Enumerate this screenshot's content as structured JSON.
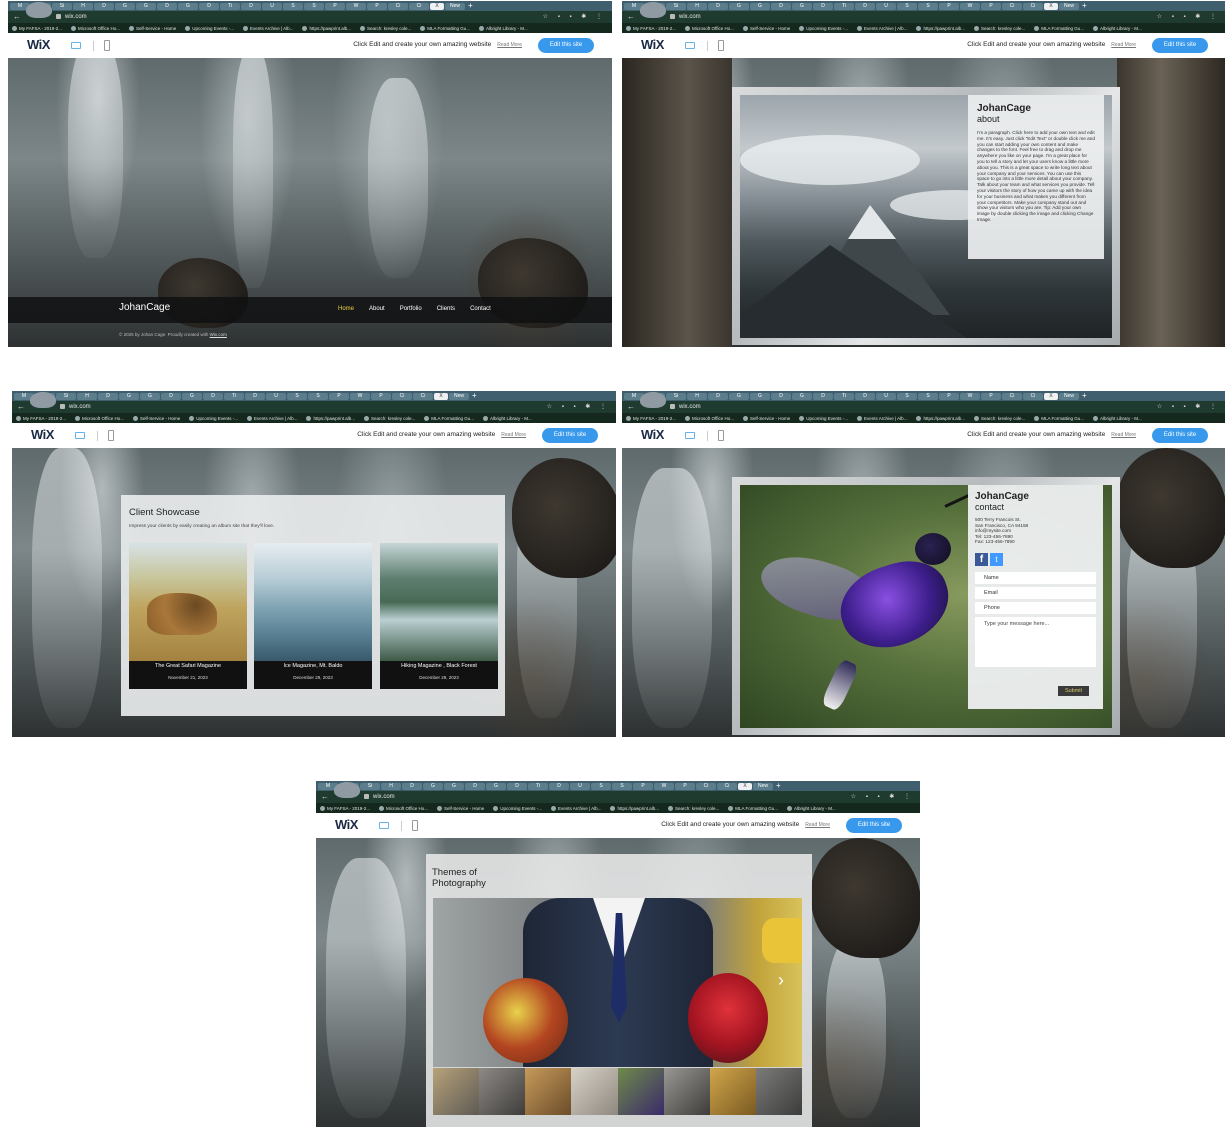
{
  "browser": {
    "url": "wix.com",
    "tabs": [
      "M",
      "Ir",
      "Si",
      "H",
      "D",
      "G",
      "G",
      "D",
      "G",
      "D",
      "Ti",
      "D",
      "U",
      "S",
      "S",
      "P",
      "W",
      "P",
      "Ci",
      "Ci",
      "U",
      "Ir",
      "N",
      "Di",
      "P",
      "X"
    ],
    "new_tab": "New",
    "bookmarks": [
      "My FAFSA - 2019-2...",
      "Microsoft Office Ho...",
      "Self-Service - Home",
      "Upcoming Events -...",
      "Events Archive | Alb...",
      "https://pawprint.alb...",
      "Search: kresley cole...",
      "MLA Formatting Gu...",
      "Albright Library - M..."
    ]
  },
  "wix": {
    "logo": "WiX",
    "promo": "Click Edit and create your own amazing website",
    "read_more": "Read More",
    "edit_button": "Edit this site"
  },
  "home": {
    "brand": "JohanCage",
    "nav": [
      "Home",
      "About",
      "Portfolio",
      "Clients",
      "Contact"
    ],
    "footer_text": "© 2025 by Johan Cage. Proudly created with",
    "footer_link": "Wix.com"
  },
  "about": {
    "name": "JohanCage",
    "heading": "about",
    "body": "I'm a paragraph. Click here to add your own text and edit me. It's easy. Just click “Edit Text” or double click me and you can start adding your own content and make changes to the font. Feel free to drag and drop me anywhere you like on your page. I'm a great place for you to tell a story and let your users know a little more about you. This is a great space to write long text about your company and your services. You can use this space to go into a little more detail about your company. Talk about your team and what services you provide. Tell your visitors the story of how you came up with the idea for your business and what makes you different from your competitors. Make your company stand out and show your visitors who you are. Tip: Add your own image by double clicking the image and clicking Change Image."
  },
  "clients": {
    "title": "Client Showcase",
    "subtitle": "Impress your clients by easily creating an album site that they'll love.",
    "items": [
      {
        "caption": "The Great Safari Magazine",
        "date": "November 21, 2023"
      },
      {
        "caption": "Ice Magazine, Mt. Baldo",
        "date": "December 29, 2023"
      },
      {
        "caption": "Hiking Magazine , Black Forest",
        "date": "December 29, 2023"
      }
    ]
  },
  "contact": {
    "name": "JohanCage",
    "heading": "contact",
    "address1": "500 Terry Francois St.",
    "address2": "San Francisco, CA 94158",
    "email": "info@mysite.com",
    "tel": "Tel: 123-456-7890",
    "fax": "Fax: 123-456-7890",
    "fields": {
      "name": "Name",
      "email": "Email",
      "phone": "Phone",
      "message": "Type your message here..."
    },
    "submit": "Submit"
  },
  "themes": {
    "title_line1": "Themes of",
    "title_line2": "Photography"
  },
  "colors": {
    "accent": "#3899ec",
    "nav_active": "#f0d13f",
    "wix_logo": "#1b2b45"
  }
}
